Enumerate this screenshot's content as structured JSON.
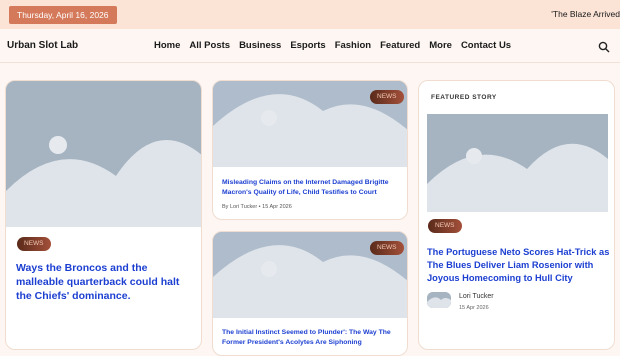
{
  "topbar": {
    "date": "Thursday, April 16, 2026",
    "ticker": "'The Blaze Arrived"
  },
  "header": {
    "logo": "Urban Slot Lab",
    "nav": [
      "Home",
      "All Posts",
      "Business",
      "Esports",
      "Fashion",
      "Featured",
      "More",
      "Contact Us"
    ]
  },
  "cards": {
    "big": {
      "badge": "NEWS",
      "title": "Ways the Broncos and the malleable quarterback could halt the Chiefs' dominance."
    },
    "mid_top": {
      "badge": "NEWS",
      "title": "Misleading Claims on the Internet Damaged Brigitte Macron's Quality of Life, Child Testifies to Court",
      "meta": "By Lori Tucker  •  15 Apr 2026"
    },
    "mid_bottom": {
      "badge": "NEWS",
      "title": "The Initial Instinct Seemed to Plunder': The Way The Former President's Acolytes Are Siphoning"
    }
  },
  "featured": {
    "label": "FEATURED STORY",
    "badge": "NEWS",
    "title": "The Portuguese Neto Scores Hat-Trick as The Blues Deliver Liam Rosenior with Joyous Homecoming to Hull City",
    "author": "Lori Tucker",
    "date": "15 Apr 2026"
  }
}
